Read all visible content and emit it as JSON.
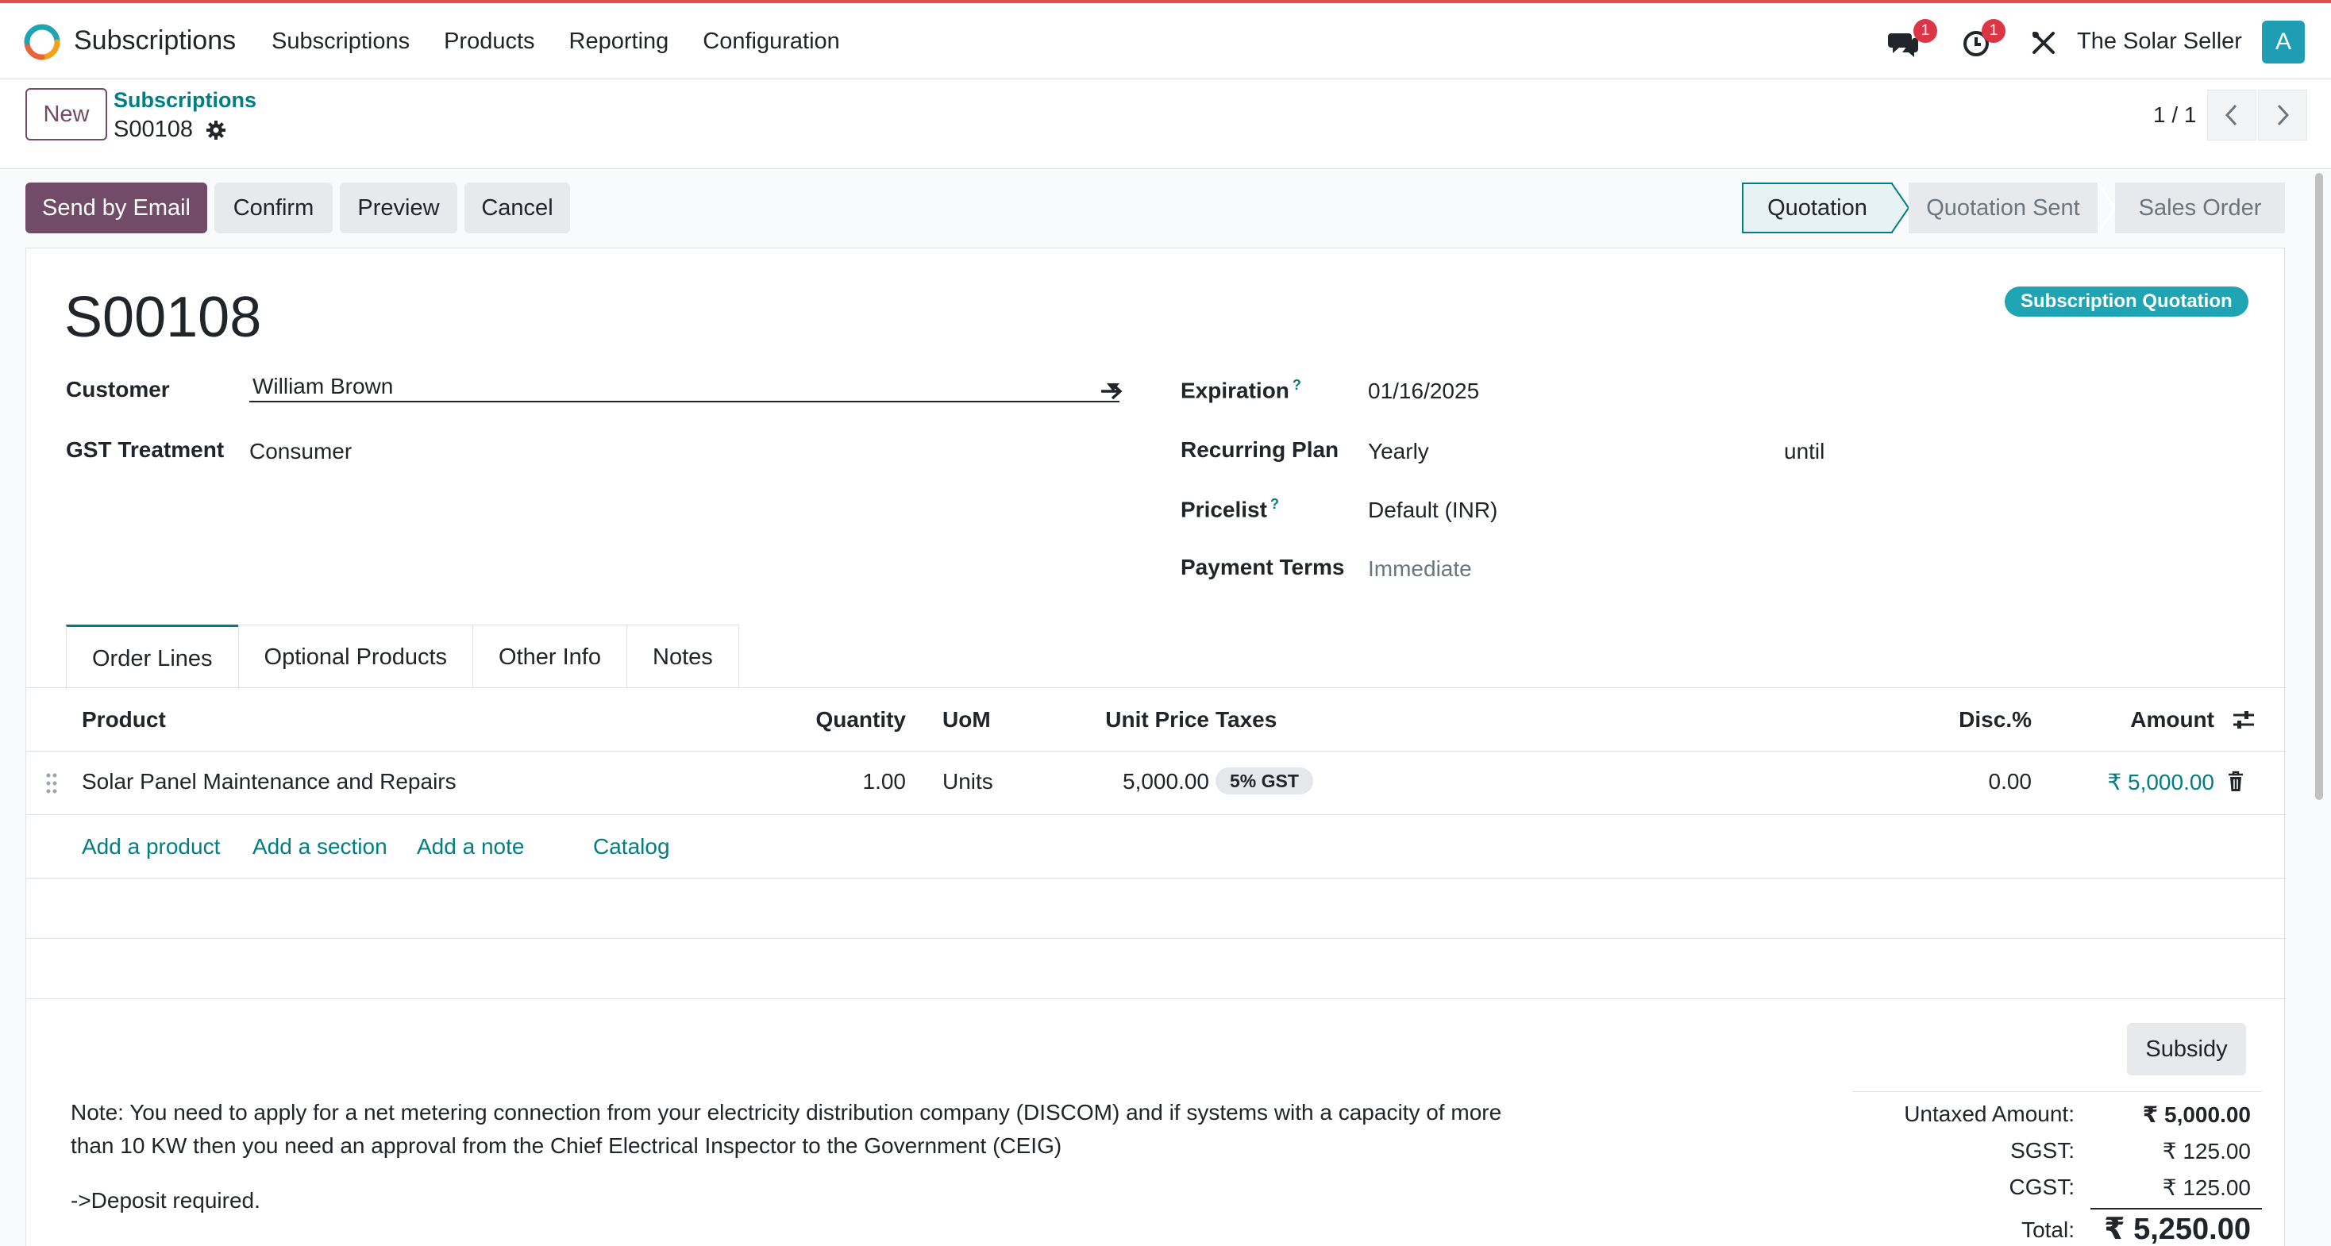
{
  "navbar": {
    "app_name": "Subscriptions",
    "menu": [
      "Subscriptions",
      "Products",
      "Reporting",
      "Configuration"
    ],
    "messages_badge": "1",
    "activities_badge": "1",
    "company": "The Solar Seller",
    "avatar_initial": "A",
    "accent_color": "#e04f4f"
  },
  "control_panel": {
    "new_label": "New",
    "breadcrumb_parent": "Subscriptions",
    "breadcrumb_current": "S00108",
    "pager": "1 / 1"
  },
  "statusbar": {
    "buttons": [
      "Send by Email",
      "Confirm",
      "Preview",
      "Cancel"
    ],
    "stages": [
      "Quotation",
      "Quotation Sent",
      "Sales Order"
    ],
    "active_stage": "Quotation"
  },
  "form": {
    "title": "S00108",
    "ribbon": "Subscription Quotation",
    "customer_label": "Customer",
    "customer_value": "William Brown",
    "gst_label": "GST Treatment",
    "gst_value": "Consumer",
    "expiration_label": "Expiration",
    "expiration_help": "?",
    "expiration_value": "01/16/2025",
    "plan_label": "Recurring Plan",
    "plan_value": "Yearly",
    "plan_until": "until",
    "pricelist_label": "Pricelist",
    "pricelist_help": "?",
    "pricelist_value": "Default (INR)",
    "terms_label": "Payment Terms",
    "terms_placeholder": "Immediate"
  },
  "tabs": [
    "Order Lines",
    "Optional Products",
    "Other Info",
    "Notes"
  ],
  "table": {
    "headers": {
      "product": "Product",
      "quantity": "Quantity",
      "uom": "UoM",
      "unit_price": "Unit Price",
      "taxes": "Taxes",
      "disc": "Disc.%",
      "amount": "Amount"
    },
    "rows": [
      {
        "product": "Solar Panel Maintenance and Repairs",
        "quantity": "1.00",
        "uom": "Units",
        "unit_price": "5,000.00",
        "tax": "5% GST",
        "disc": "0.00",
        "amount": "₹ 5,000.00"
      }
    ],
    "add_links": [
      "Add a product",
      "Add a section",
      "Add a note",
      "Catalog"
    ]
  },
  "note": "Note: You need to apply for a net metering connection from your electricity distribution company (DISCOM) and if systems with a capacity of more than 10 KW then you need an approval from the Chief Electrical Inspector to the Government (CEIG)",
  "deposit_note": "->Deposit required.",
  "subsidy_label": "Subsidy",
  "totals": {
    "untaxed_label": "Untaxed Amount:",
    "untaxed_value": "₹ 5,000.00",
    "sgst_label": "SGST:",
    "sgst_value": "₹ 125.00",
    "cgst_label": "CGST:",
    "cgst_value": "₹ 125.00",
    "total_label": "Total:",
    "total_value": "₹ 5,250.00"
  }
}
